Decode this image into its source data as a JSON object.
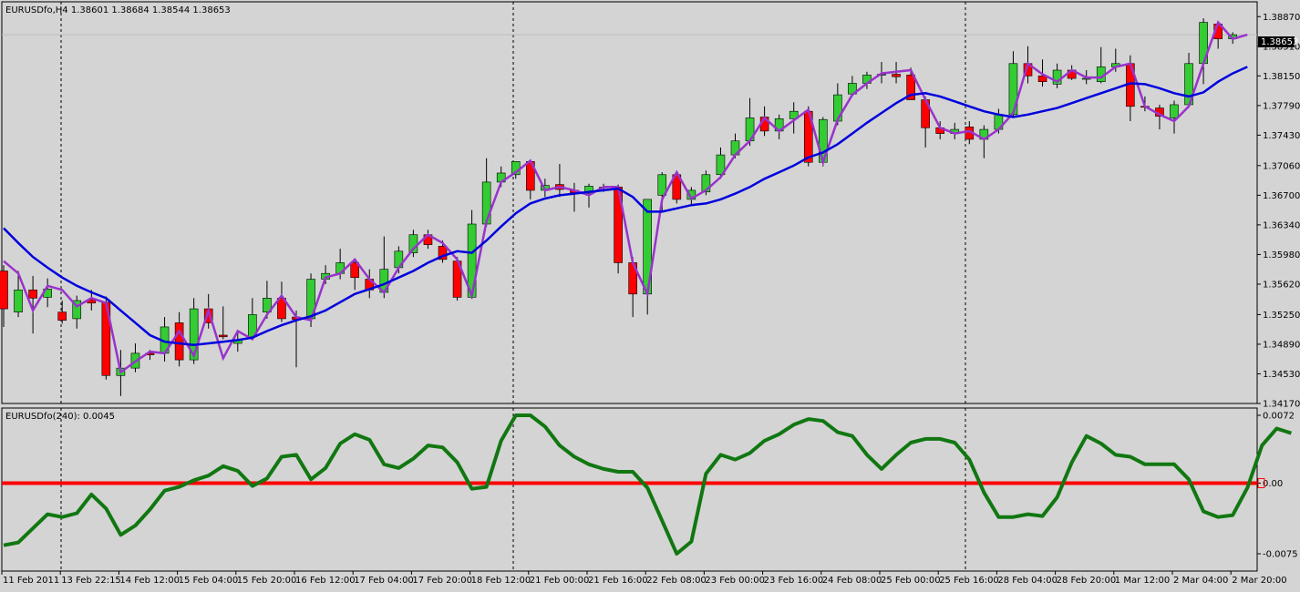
{
  "price_panel": {
    "label": "EURUSDfo,H4  1.38601 1.38684 1.38544 1.38653",
    "current_price_label": "1.38653"
  },
  "oscillator_panel": {
    "label": "EURUSDfo(240):  0.0045",
    "zero_marker": "0.00"
  },
  "colors": {
    "background": "#d4d4d4",
    "bull_candle": "#33cc33",
    "bear_candle": "#ff0000",
    "fast_ma": "#9933cc",
    "slow_ma": "#0000dd",
    "oscillator": "#117711",
    "zero_line": "#ff0000"
  },
  "chart_data": [
    {
      "type": "candlestick",
      "ylim": [
        1.3417,
        1.3905
      ],
      "yticks": [
        1.3887,
        1.3851,
        1.3815,
        1.3779,
        1.3743,
        1.3706,
        1.367,
        1.3634,
        1.3598,
        1.3562,
        1.3525,
        1.3489,
        1.3453,
        1.3417
      ],
      "ytick_labels": [
        "1.38870",
        "1.38510",
        "1.38150",
        "1.37790",
        "1.37430",
        "1.37060",
        "1.36700",
        "1.36340",
        "1.35980",
        "1.35620",
        "1.35250",
        "1.34890",
        "1.34530",
        "1.34170"
      ],
      "xtick_labels": [
        "11 Feb 2011",
        "13 Feb 22:15",
        "14 Feb 12:00",
        "15 Feb 04:00",
        "15 Feb 20:00",
        "16 Feb 12:00",
        "17 Feb 04:00",
        "17 Feb 20:00",
        "18 Feb 12:00",
        "21 Feb 00:00",
        "21 Feb 16:00",
        "22 Feb 08:00",
        "23 Feb 00:00",
        "23 Feb 16:00",
        "24 Feb 08:00",
        "25 Feb 00:00",
        "25 Feb 16:00",
        "28 Feb 04:00",
        "28 Feb 20:00",
        "1 Mar 12:00",
        "2 Mar 04:00",
        "2 Mar 20:00"
      ],
      "candles": [
        {
          "o": 1.3578,
          "h": 1.3585,
          "l": 1.351,
          "c": 1.3532
        },
        {
          "o": 1.3528,
          "h": 1.3578,
          "l": 1.3522,
          "c": 1.3555
        },
        {
          "o": 1.3555,
          "h": 1.3572,
          "l": 1.3502,
          "c": 1.3545
        },
        {
          "o": 1.3546,
          "h": 1.3569,
          "l": 1.3534,
          "c": 1.3556
        },
        {
          "o": 1.3528,
          "h": 1.3542,
          "l": 1.3514,
          "c": 1.3518
        },
        {
          "o": 1.352,
          "h": 1.3548,
          "l": 1.3508,
          "c": 1.3542
        },
        {
          "o": 1.3543,
          "h": 1.3555,
          "l": 1.353,
          "c": 1.3539
        },
        {
          "o": 1.354,
          "h": 1.3547,
          "l": 1.3446,
          "c": 1.3451
        },
        {
          "o": 1.3451,
          "h": 1.3482,
          "l": 1.3426,
          "c": 1.346
        },
        {
          "o": 1.346,
          "h": 1.349,
          "l": 1.3455,
          "c": 1.3478
        },
        {
          "o": 1.3478,
          "h": 1.3482,
          "l": 1.347,
          "c": 1.3476
        },
        {
          "o": 1.3478,
          "h": 1.3522,
          "l": 1.3468,
          "c": 1.351
        },
        {
          "o": 1.3515,
          "h": 1.3528,
          "l": 1.3462,
          "c": 1.347
        },
        {
          "o": 1.347,
          "h": 1.3545,
          "l": 1.3465,
          "c": 1.3532
        },
        {
          "o": 1.3532,
          "h": 1.355,
          "l": 1.3508,
          "c": 1.3515
        },
        {
          "o": 1.35,
          "h": 1.3535,
          "l": 1.3495,
          "c": 1.3498
        },
        {
          "o": 1.349,
          "h": 1.3505,
          "l": 1.348,
          "c": 1.3494
        },
        {
          "o": 1.3498,
          "h": 1.3545,
          "l": 1.3495,
          "c": 1.3525
        },
        {
          "o": 1.3528,
          "h": 1.3566,
          "l": 1.352,
          "c": 1.3545
        },
        {
          "o": 1.3545,
          "h": 1.3565,
          "l": 1.3516,
          "c": 1.352
        },
        {
          "o": 1.3522,
          "h": 1.353,
          "l": 1.3461,
          "c": 1.3519
        },
        {
          "o": 1.352,
          "h": 1.3575,
          "l": 1.351,
          "c": 1.3568
        },
        {
          "o": 1.3568,
          "h": 1.3585,
          "l": 1.3562,
          "c": 1.3575
        },
        {
          "o": 1.3575,
          "h": 1.3605,
          "l": 1.3568,
          "c": 1.3588
        },
        {
          "o": 1.3588,
          "h": 1.3593,
          "l": 1.3555,
          "c": 1.357
        },
        {
          "o": 1.3568,
          "h": 1.358,
          "l": 1.3545,
          "c": 1.3555
        },
        {
          "o": 1.3552,
          "h": 1.362,
          "l": 1.3545,
          "c": 1.358
        },
        {
          "o": 1.3582,
          "h": 1.3608,
          "l": 1.3575,
          "c": 1.3602
        },
        {
          "o": 1.36,
          "h": 1.3628,
          "l": 1.3595,
          "c": 1.3622
        },
        {
          "o": 1.3622,
          "h": 1.3628,
          "l": 1.3605,
          "c": 1.361
        },
        {
          "o": 1.3608,
          "h": 1.3615,
          "l": 1.3588,
          "c": 1.3592
        },
        {
          "o": 1.359,
          "h": 1.3595,
          "l": 1.3542,
          "c": 1.3546
        },
        {
          "o": 1.3546,
          "h": 1.3652,
          "l": 1.3544,
          "c": 1.3635
        },
        {
          "o": 1.3635,
          "h": 1.3715,
          "l": 1.3632,
          "c": 1.3686
        },
        {
          "o": 1.3686,
          "h": 1.3705,
          "l": 1.368,
          "c": 1.3697
        },
        {
          "o": 1.3695,
          "h": 1.371,
          "l": 1.369,
          "c": 1.3711
        },
        {
          "o": 1.3711,
          "h": 1.3711,
          "l": 1.3665,
          "c": 1.3676
        },
        {
          "o": 1.3676,
          "h": 1.369,
          "l": 1.3668,
          "c": 1.3682
        },
        {
          "o": 1.3683,
          "h": 1.3708,
          "l": 1.3668,
          "c": 1.3677
        },
        {
          "o": 1.3676,
          "h": 1.3685,
          "l": 1.365,
          "c": 1.3673
        },
        {
          "o": 1.3672,
          "h": 1.3684,
          "l": 1.3655,
          "c": 1.3681
        },
        {
          "o": 1.368,
          "h": 1.3684,
          "l": 1.3674,
          "c": 1.368
        },
        {
          "o": 1.368,
          "h": 1.3683,
          "l": 1.3575,
          "c": 1.3588
        },
        {
          "o": 1.3588,
          "h": 1.3595,
          "l": 1.3522,
          "c": 1.355
        },
        {
          "o": 1.355,
          "h": 1.3665,
          "l": 1.3525,
          "c": 1.3665
        },
        {
          "o": 1.367,
          "h": 1.3698,
          "l": 1.365,
          "c": 1.3695
        },
        {
          "o": 1.3695,
          "h": 1.3695,
          "l": 1.366,
          "c": 1.3665
        },
        {
          "o": 1.3665,
          "h": 1.368,
          "l": 1.3658,
          "c": 1.3676
        },
        {
          "o": 1.3674,
          "h": 1.37,
          "l": 1.367,
          "c": 1.3695
        },
        {
          "o": 1.3695,
          "h": 1.3728,
          "l": 1.369,
          "c": 1.3719
        },
        {
          "o": 1.3719,
          "h": 1.3745,
          "l": 1.3715,
          "c": 1.3736
        },
        {
          "o": 1.3736,
          "h": 1.3788,
          "l": 1.373,
          "c": 1.3764
        },
        {
          "o": 1.3765,
          "h": 1.3778,
          "l": 1.3742,
          "c": 1.3748
        },
        {
          "o": 1.3748,
          "h": 1.3768,
          "l": 1.3738,
          "c": 1.3763
        },
        {
          "o": 1.3763,
          "h": 1.3783,
          "l": 1.3745,
          "c": 1.3772
        },
        {
          "o": 1.3772,
          "h": 1.3778,
          "l": 1.3705,
          "c": 1.371
        },
        {
          "o": 1.371,
          "h": 1.3765,
          "l": 1.3705,
          "c": 1.3762
        },
        {
          "o": 1.376,
          "h": 1.3806,
          "l": 1.3755,
          "c": 1.3792
        },
        {
          "o": 1.3793,
          "h": 1.3815,
          "l": 1.379,
          "c": 1.3806
        },
        {
          "o": 1.3806,
          "h": 1.382,
          "l": 1.3799,
          "c": 1.3816
        },
        {
          "o": 1.3816,
          "h": 1.3832,
          "l": 1.3806,
          "c": 1.3817
        },
        {
          "o": 1.3817,
          "h": 1.3832,
          "l": 1.3806,
          "c": 1.3814
        },
        {
          "o": 1.3816,
          "h": 1.3825,
          "l": 1.3792,
          "c": 1.3786
        },
        {
          "o": 1.3786,
          "h": 1.379,
          "l": 1.3728,
          "c": 1.3752
        },
        {
          "o": 1.3752,
          "h": 1.376,
          "l": 1.3738,
          "c": 1.3745
        },
        {
          "o": 1.3745,
          "h": 1.3758,
          "l": 1.3738,
          "c": 1.375
        },
        {
          "o": 1.3753,
          "h": 1.376,
          "l": 1.3732,
          "c": 1.3738
        },
        {
          "o": 1.3738,
          "h": 1.3755,
          "l": 1.3715,
          "c": 1.375
        },
        {
          "o": 1.375,
          "h": 1.3775,
          "l": 1.3745,
          "c": 1.3768
        },
        {
          "o": 1.3768,
          "h": 1.3845,
          "l": 1.3765,
          "c": 1.383
        },
        {
          "o": 1.383,
          "h": 1.3851,
          "l": 1.3806,
          "c": 1.3815
        },
        {
          "o": 1.3815,
          "h": 1.3835,
          "l": 1.3802,
          "c": 1.3808
        },
        {
          "o": 1.3805,
          "h": 1.383,
          "l": 1.38,
          "c": 1.3822
        },
        {
          "o": 1.3822,
          "h": 1.3828,
          "l": 1.381,
          "c": 1.3812
        },
        {
          "o": 1.3812,
          "h": 1.3822,
          "l": 1.3805,
          "c": 1.3812
        },
        {
          "o": 1.3808,
          "h": 1.385,
          "l": 1.3806,
          "c": 1.3826
        },
        {
          "o": 1.3826,
          "h": 1.3848,
          "l": 1.382,
          "c": 1.383
        },
        {
          "o": 1.383,
          "h": 1.384,
          "l": 1.376,
          "c": 1.3778
        },
        {
          "o": 1.3778,
          "h": 1.379,
          "l": 1.3772,
          "c": 1.3777
        },
        {
          "o": 1.3776,
          "h": 1.378,
          "l": 1.375,
          "c": 1.3766
        },
        {
          "o": 1.3764,
          "h": 1.3785,
          "l": 1.3745,
          "c": 1.378
        },
        {
          "o": 1.378,
          "h": 1.3843,
          "l": 1.3778,
          "c": 1.383
        },
        {
          "o": 1.383,
          "h": 1.3885,
          "l": 1.3805,
          "c": 1.388
        },
        {
          "o": 1.3878,
          "h": 1.388,
          "l": 1.3848,
          "c": 1.386
        },
        {
          "o": 1.386,
          "h": 1.3868,
          "l": 1.3854,
          "c": 1.3865
        }
      ],
      "series": [
        {
          "values": [
            1.359,
            1.3575,
            1.353,
            1.356,
            1.3555,
            1.3535,
            1.3545,
            1.3539,
            1.3455,
            1.3468,
            1.348,
            1.3478,
            1.3505,
            1.3475,
            1.353,
            1.3472,
            1.3505,
            1.3495,
            1.3525,
            1.3548,
            1.3522,
            1.3518,
            1.357,
            1.3575,
            1.3592,
            1.3568,
            1.3552,
            1.3582,
            1.3605,
            1.3622,
            1.3612,
            1.3592,
            1.3548,
            1.3638,
            1.3686,
            1.3698,
            1.3712,
            1.3676,
            1.368,
            1.3676,
            1.367,
            1.368,
            1.368,
            1.3588,
            1.355,
            1.3665,
            1.3698,
            1.3666,
            1.3676,
            1.3692,
            1.3719,
            1.3736,
            1.3764,
            1.3748,
            1.3761,
            1.3774,
            1.371,
            1.3762,
            1.3792,
            1.3806,
            1.3818,
            1.382,
            1.3822,
            1.3786,
            1.3752,
            1.3745,
            1.3748,
            1.3738,
            1.375,
            1.377,
            1.383,
            1.3817,
            1.3808,
            1.3822,
            1.3813,
            1.3813,
            1.3826,
            1.383,
            1.3778,
            1.3768,
            1.376,
            1.3778,
            1.383,
            1.388,
            1.386,
            1.3865
          ]
        },
        {
          "values": [
            1.363,
            1.3612,
            1.3595,
            1.3582,
            1.357,
            1.356,
            1.3552,
            1.3545,
            1.353,
            1.3515,
            1.35,
            1.3492,
            1.349,
            1.3488,
            1.349,
            1.3492,
            1.3494,
            1.3497,
            1.3505,
            1.3512,
            1.3518,
            1.3523,
            1.353,
            1.354,
            1.355,
            1.3556,
            1.3562,
            1.357,
            1.3578,
            1.3588,
            1.3596,
            1.3602,
            1.36,
            1.3615,
            1.3632,
            1.3648,
            1.366,
            1.3666,
            1.367,
            1.3672,
            1.3674,
            1.3676,
            1.3678,
            1.3668,
            1.365,
            1.365,
            1.3654,
            1.3658,
            1.366,
            1.3665,
            1.3672,
            1.368,
            1.369,
            1.3698,
            1.3706,
            1.3716,
            1.3722,
            1.3732,
            1.3745,
            1.3758,
            1.377,
            1.3782,
            1.3792,
            1.3794,
            1.379,
            1.3784,
            1.3778,
            1.3772,
            1.3768,
            1.3765,
            1.3768,
            1.3772,
            1.3776,
            1.3782,
            1.3788,
            1.3794,
            1.38,
            1.3806,
            1.3805,
            1.38,
            1.3794,
            1.379,
            1.3795,
            1.3808,
            1.3818,
            1.3826
          ]
        }
      ]
    },
    {
      "type": "line",
      "ylim": [
        -0.0075,
        0.0072
      ],
      "yticks": [
        0.0072,
        0.0,
        -0.0075
      ],
      "ytick_labels": [
        "0.0072",
        "0.00",
        "-0.0075"
      ],
      "hline": 0.0,
      "series": [
        {
          "values": [
            -0.0066,
            -0.0063,
            -0.0048,
            -0.0033,
            -0.0036,
            -0.0032,
            -0.0012,
            -0.0027,
            -0.0055,
            -0.0045,
            -0.0028,
            -0.0008,
            -0.0004,
            0.0003,
            0.0008,
            0.0018,
            0.0013,
            -0.0003,
            0.0005,
            0.0028,
            0.003,
            0.0004,
            0.0016,
            0.0042,
            0.0052,
            0.0046,
            0.002,
            0.0016,
            0.0026,
            0.004,
            0.0038,
            0.0022,
            -0.0006,
            -0.0004,
            0.0045,
            0.0072,
            0.0072,
            0.006,
            0.004,
            0.0028,
            0.002,
            0.0015,
            0.0012,
            0.0012,
            -0.0005,
            -0.004,
            -0.0075,
            -0.0062,
            0.001,
            0.003,
            0.0025,
            0.0032,
            0.0045,
            0.0052,
            0.0062,
            0.0068,
            0.0066,
            0.0054,
            0.005,
            0.003,
            0.0015,
            0.003,
            0.0043,
            0.0047,
            0.0047,
            0.0043,
            0.0025,
            -0.001,
            -0.0036,
            -0.0036,
            -0.0033,
            -0.0035,
            -0.0015,
            0.0022,
            0.005,
            0.0042,
            0.003,
            0.0028,
            0.002,
            0.002,
            0.002,
            0.0004,
            -0.003,
            -0.0036,
            -0.0034,
            -0.0005,
            0.004,
            0.0058,
            0.0053
          ]
        }
      ]
    }
  ]
}
